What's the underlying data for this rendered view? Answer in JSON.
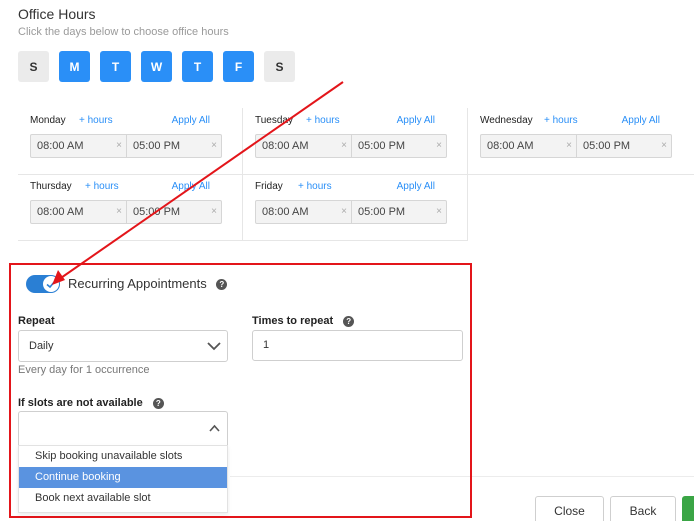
{
  "header": {
    "title": "Office Hours",
    "subtitle": "Click the days below to choose office hours"
  },
  "days": [
    {
      "label": "S",
      "selected": false
    },
    {
      "label": "M",
      "selected": true
    },
    {
      "label": "T",
      "selected": true
    },
    {
      "label": "W",
      "selected": true
    },
    {
      "label": "T",
      "selected": true
    },
    {
      "label": "F",
      "selected": true
    },
    {
      "label": "S",
      "selected": false
    }
  ],
  "schedule": [
    {
      "day": "Monday",
      "add_hours": "+ hours",
      "apply_all": "Apply All",
      "start": "08:00 AM",
      "end": "05:00 PM"
    },
    {
      "day": "Tuesday",
      "add_hours": "+ hours",
      "apply_all": "Apply All",
      "start": "08:00 AM",
      "end": "05:00 PM"
    },
    {
      "day": "Wednesday",
      "add_hours": "+ hours",
      "apply_all": "Apply All",
      "start": "08:00 AM",
      "end": "05:00 PM"
    },
    {
      "day": "Thursday",
      "add_hours": "+ hours",
      "apply_all": "Apply All",
      "start": "08:00 AM",
      "end": "05:00 PM"
    },
    {
      "day": "Friday",
      "add_hours": "+ hours",
      "apply_all": "Apply All",
      "start": "08:00 AM",
      "end": "05:00 PM"
    }
  ],
  "clear_glyph": "×",
  "recurring": {
    "enabled": true,
    "label": "Recurring Appointments",
    "help_glyph": "?"
  },
  "repeat": {
    "label": "Repeat",
    "value": "Daily",
    "hint": "Every day for 1 occurrence"
  },
  "times": {
    "label": "Times to repeat",
    "value": "1"
  },
  "slots": {
    "label": "If slots are not available",
    "value": "",
    "options": [
      "Skip booking unavailable slots",
      "Continue booking",
      "Book next available slot"
    ],
    "highlighted": "Continue booking"
  },
  "footer": {
    "close_label": "Close",
    "back_label": "Back"
  },
  "colors": {
    "accent": "#2a8ff7",
    "highlight_box": "#e3151a",
    "annotation_arrow": "#e3151a",
    "toggle_on": "#2a7fd4",
    "option_highlight": "#5a93e0",
    "primary_button": "#3aa545"
  },
  "icons": {
    "repeat_select": "chevron-down-icon",
    "slots_select": "chevron-up-icon",
    "help": "question-circle-icon",
    "clear": "close-icon"
  }
}
